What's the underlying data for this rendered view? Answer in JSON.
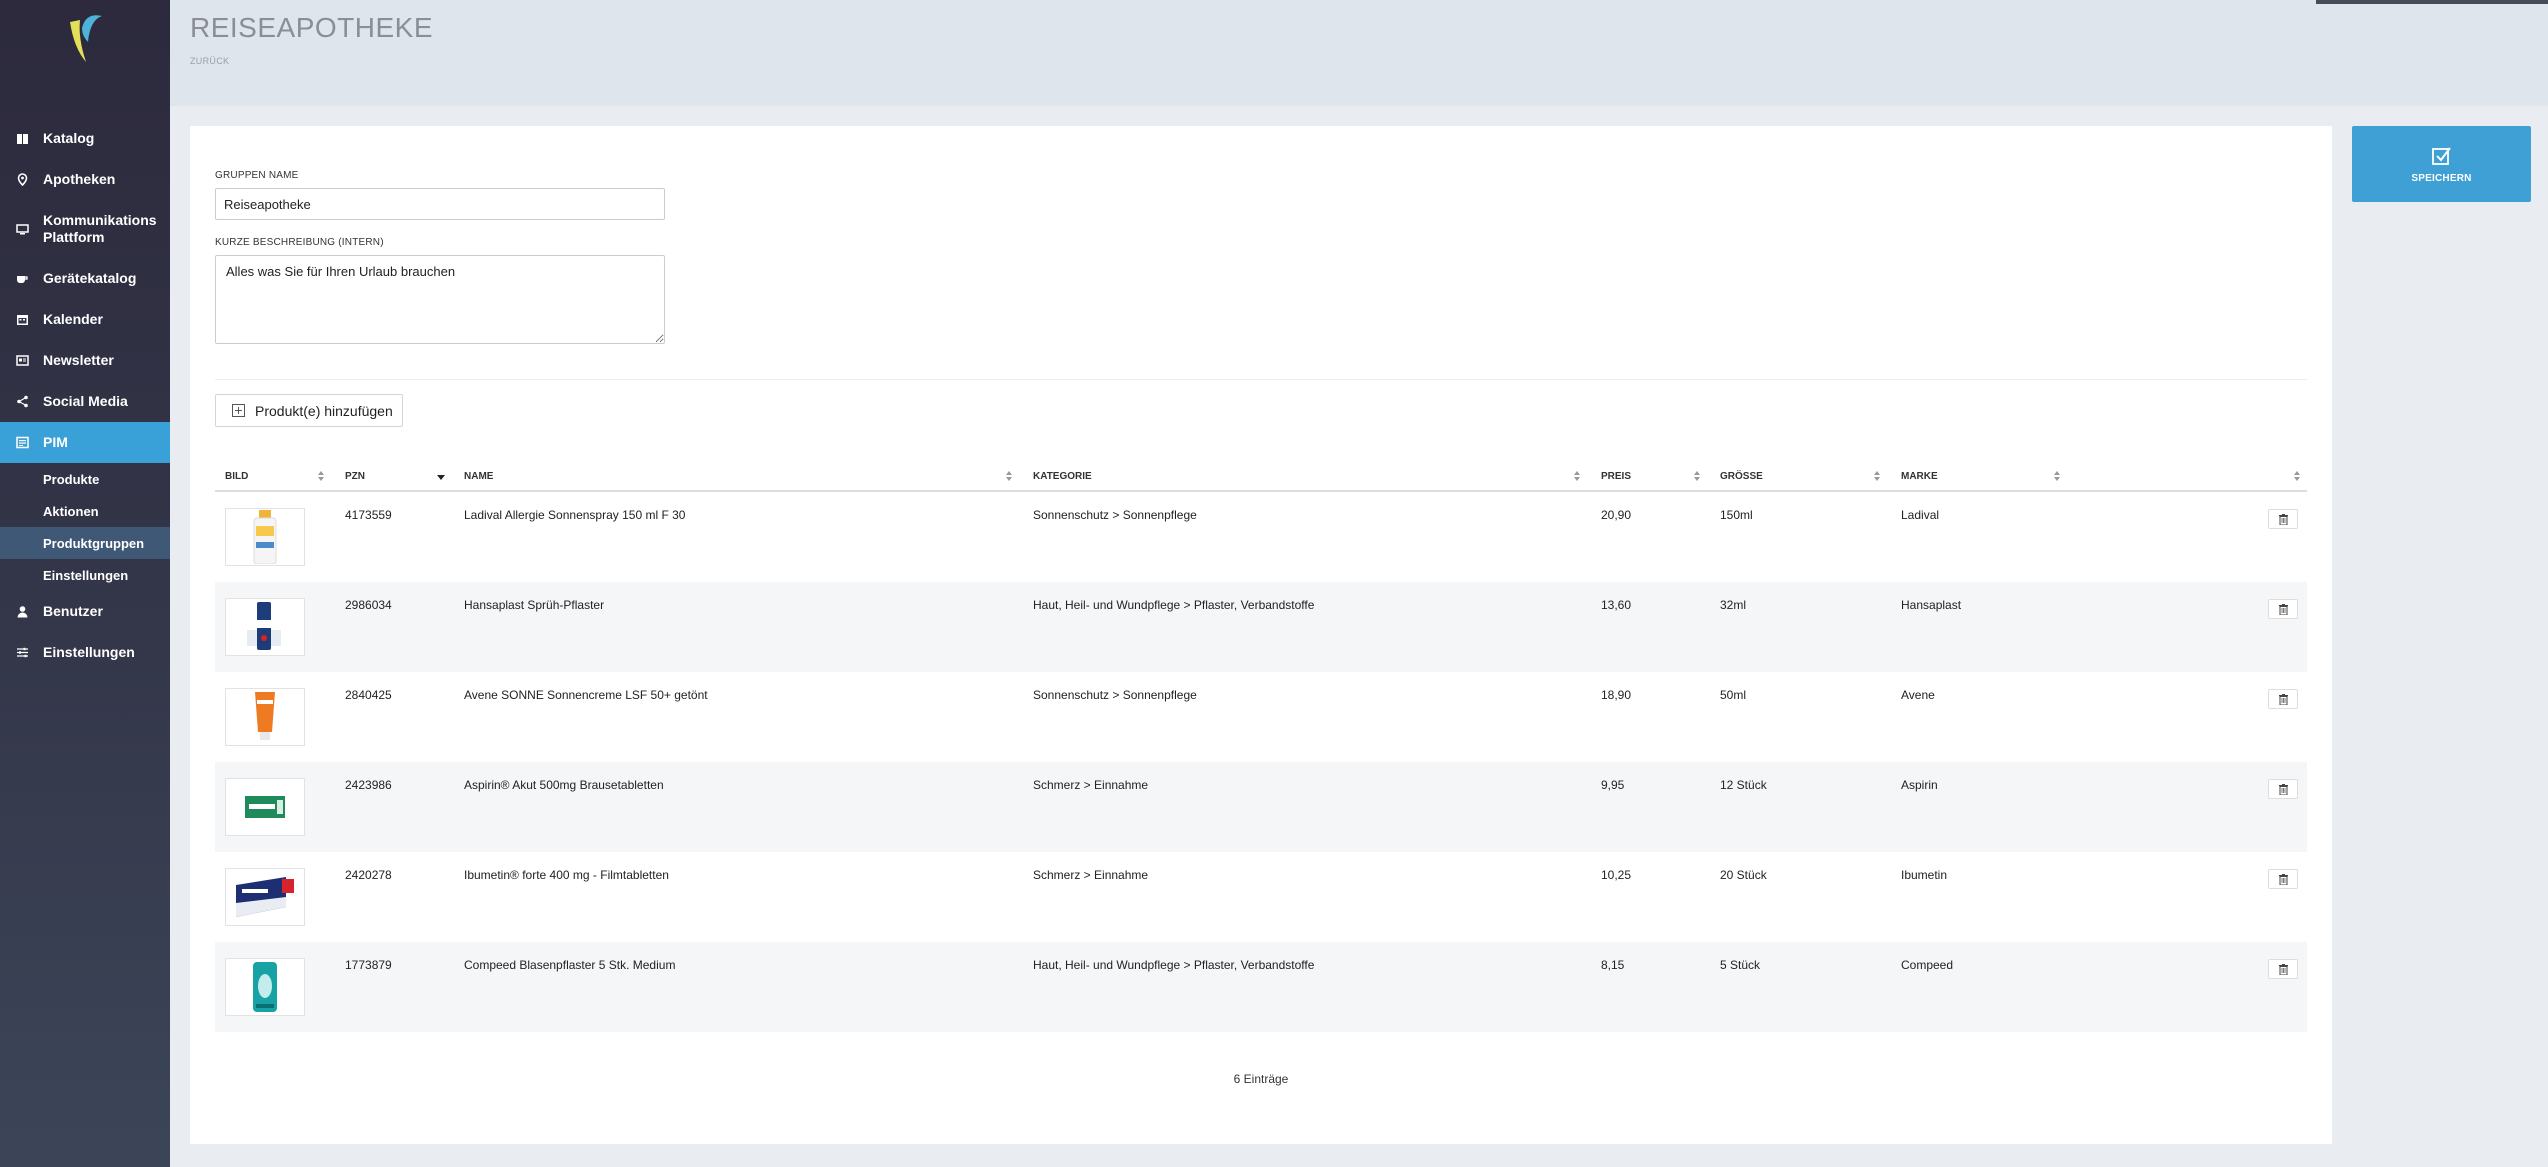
{
  "header": {
    "title": "REISEAPOTHEKE",
    "back_label": "ZURÜCK"
  },
  "sidebar": {
    "items": [
      {
        "label": "Katalog",
        "icon": "book-icon"
      },
      {
        "label": "Apotheken",
        "icon": "map-pin-icon"
      },
      {
        "label": "Kommunikations Plattform",
        "icon": "monitor-icon"
      },
      {
        "label": "Gerätekatalog",
        "icon": "cup-icon"
      },
      {
        "label": "Kalender",
        "icon": "calendar-icon"
      },
      {
        "label": "Newsletter",
        "icon": "newspaper-icon"
      },
      {
        "label": "Social Media",
        "icon": "share-icon"
      },
      {
        "label": "PIM",
        "icon": "list-icon"
      },
      {
        "label": "Benutzer",
        "icon": "user-icon"
      },
      {
        "label": "Einstellungen",
        "icon": "sliders-icon"
      }
    ],
    "pim_sub": [
      {
        "label": "Produkte"
      },
      {
        "label": "Aktionen"
      },
      {
        "label": "Produktgruppen"
      },
      {
        "label": "Einstellungen"
      }
    ],
    "active": "PIM",
    "active_sub": "Produktgruppen",
    "accent_color": "#3aa0d8"
  },
  "form": {
    "name_label": "GRUPPEN NAME",
    "name_value": "Reiseapotheke",
    "desc_label": "KURZE BESCHREIBUNG (INTERN)",
    "desc_value": "Alles was Sie für Ihren Urlaub brauchen",
    "add_label": "Produkt(e) hinzufügen"
  },
  "table": {
    "columns": [
      "BILD",
      "PZN",
      "NAME",
      "KATEGORIE",
      "PREIS",
      "GRÖSSE",
      "MARKE"
    ],
    "sorted_column": "PZN",
    "sort_direction": "desc",
    "rows": [
      {
        "pzn": "4173559",
        "name": "Ladival Allergie Sonnenspray 150 ml F 30",
        "kategorie": "Sonnenschutz > Sonnenpflege",
        "preis": "20,90",
        "groesse": "150ml",
        "marke": "Ladival"
      },
      {
        "pzn": "2986034",
        "name": "Hansaplast Sprüh-Pflaster",
        "kategorie": "Haut, Heil- und Wundpflege > Pflaster, Verbandstoffe",
        "preis": "13,60",
        "groesse": "32ml",
        "marke": "Hansaplast"
      },
      {
        "pzn": "2840425",
        "name": "Avene SONNE Sonnencreme LSF 50+ getönt",
        "kategorie": "Sonnenschutz > Sonnenpflege",
        "preis": "18,90",
        "groesse": "50ml",
        "marke": "Avene"
      },
      {
        "pzn": "2423986",
        "name": "Aspirin® Akut 500mg Brausetabletten",
        "kategorie": "Schmerz > Einnahme",
        "preis": "9,95",
        "groesse": "12 Stück",
        "marke": "Aspirin"
      },
      {
        "pzn": "2420278",
        "name": "Ibumetin® forte 400 mg - Filmtabletten",
        "kategorie": "Schmerz > Einnahme",
        "preis": "10,25",
        "groesse": "20 Stück",
        "marke": "Ibumetin"
      },
      {
        "pzn": "1773879",
        "name": "Compeed Blasenpflaster 5 Stk. Medium",
        "kategorie": "Haut, Heil- und Wundpflege > Pflaster, Verbandstoffe",
        "preis": "8,15",
        "groesse": "5 Stück",
        "marke": "Compeed"
      }
    ],
    "count_label": "6 Einträge"
  },
  "actions": {
    "save_label": "SPEICHERN",
    "save_color": "#3ea0d4"
  }
}
